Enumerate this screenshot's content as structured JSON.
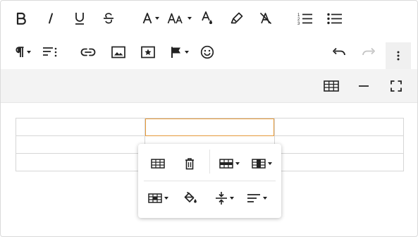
{
  "toolbar": {
    "row1": [
      {
        "name": "bold-button",
        "icon": "bold-icon",
        "has_caret": false
      },
      {
        "name": "italic-button",
        "icon": "italic-icon",
        "has_caret": false
      },
      {
        "name": "underline-button",
        "icon": "underline-icon",
        "has_caret": false
      },
      {
        "name": "strikethrough-button",
        "icon": "strikethrough-icon",
        "has_caret": false
      },
      {
        "name": "text-color-button",
        "icon": "font-color-icon",
        "has_caret": true
      },
      {
        "name": "font-size-button",
        "icon": "font-size-icon",
        "has_caret": true
      },
      {
        "name": "background-color-button",
        "icon": "fill-drop-icon",
        "has_caret": false
      },
      {
        "name": "highlight-button",
        "icon": "highlighter-icon",
        "has_caret": false
      },
      {
        "name": "clear-format-button",
        "icon": "clear-format-icon",
        "has_caret": false
      },
      {
        "name": "ordered-list-button",
        "icon": "ordered-list-icon",
        "has_caret": false
      },
      {
        "name": "unordered-list-button",
        "icon": "unordered-list-icon",
        "has_caret": false
      }
    ],
    "row2": [
      {
        "name": "paragraph-button",
        "icon": "paragraph-icon",
        "has_caret": true
      },
      {
        "name": "paragraph-format-button",
        "icon": "paragraph-format-icon",
        "has_caret": false
      },
      {
        "name": "insert-link-button",
        "icon": "link-icon",
        "has_caret": false
      },
      {
        "name": "insert-image-button",
        "icon": "image-icon",
        "has_caret": false
      },
      {
        "name": "insert-media-button",
        "icon": "star-box-icon",
        "has_caret": false
      },
      {
        "name": "flag-button",
        "icon": "flag-icon",
        "has_caret": true
      },
      {
        "name": "emoji-button",
        "icon": "emoji-icon",
        "has_caret": false
      },
      {
        "name": "undo-button",
        "icon": "undo-icon",
        "has_caret": false
      },
      {
        "name": "redo-button",
        "icon": "redo-icon",
        "has_caret": false
      },
      {
        "name": "more-button",
        "icon": "more-vertical-icon",
        "has_caret": false
      }
    ],
    "row3": [
      {
        "name": "insert-table-button",
        "icon": "table-icon"
      },
      {
        "name": "insert-horizontal-line-button",
        "icon": "horizontal-line-icon"
      },
      {
        "name": "fullscreen-button",
        "icon": "fullscreen-icon"
      }
    ]
  },
  "table": {
    "rows": 3,
    "cols": 3,
    "selected_cell": [
      0,
      1
    ],
    "cells": [
      [
        "",
        "",
        ""
      ],
      [
        "",
        "",
        ""
      ],
      [
        "",
        "",
        ""
      ]
    ]
  },
  "table_popup": {
    "row1": [
      {
        "name": "table-header-button",
        "icon": "table-header-icon",
        "has_caret": false
      },
      {
        "name": "remove-table-button",
        "icon": "trash-icon",
        "has_caret": false
      },
      {
        "name": "table-rows-button",
        "icon": "table-rows-icon",
        "has_caret": true
      },
      {
        "name": "table-columns-button",
        "icon": "table-columns-icon",
        "has_caret": true
      }
    ],
    "row2": [
      {
        "name": "table-cells-button",
        "icon": "table-cells-icon",
        "has_caret": true
      },
      {
        "name": "cell-background-button",
        "icon": "paint-bucket-icon",
        "has_caret": false
      },
      {
        "name": "vertical-align-button",
        "icon": "vertical-align-icon",
        "has_caret": true
      },
      {
        "name": "horizontal-align-button",
        "icon": "align-left-icon",
        "has_caret": true
      }
    ]
  },
  "colors": {
    "icon": "#222222",
    "icon_disabled": "#c4c4c4",
    "selected_cell_border": "#e69a3a",
    "subbar_background": "#f3f3f3"
  }
}
